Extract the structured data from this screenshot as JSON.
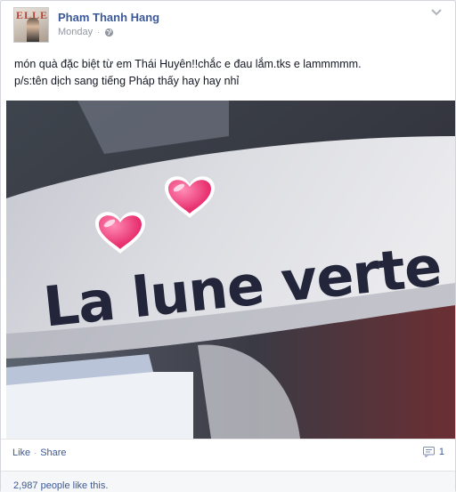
{
  "post": {
    "author": "Pham Thanh Hang",
    "timestamp": "Monday",
    "privacy_icon": "globe-icon",
    "avatar_text": "ELLE",
    "lines": [
      "món quà đặc biệt từ em Thái Huyên!!chắc e đau lắm.tks e lammmmm.",
      "p/s:tên dịch sang tiếng Pháp thấy hay hay nhỉ"
    ],
    "photo_text": "La lune verte"
  },
  "actions": {
    "like_label": "Like",
    "separator": "·",
    "share_label": "Share",
    "comment_count": "1"
  },
  "likes": {
    "summary": "2,987 people like this."
  },
  "colors": {
    "link": "#3b5998",
    "meta": "#9197a3",
    "heart": "#e83c7c"
  }
}
